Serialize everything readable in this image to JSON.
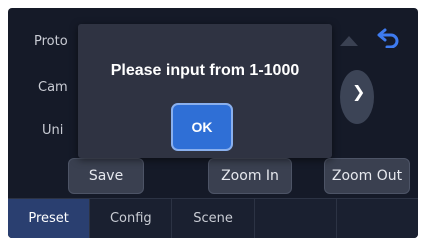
{
  "form": {
    "protocol_label": "Proto",
    "camera_label": "Cam",
    "unit_label": "Uni"
  },
  "controls": {
    "save_label": "Save",
    "zoom_in_label": "Zoom In",
    "zoom_out_label": "Zoom Out",
    "right_arrow_glyph": "❯"
  },
  "icons": {
    "back": "back-arrow-icon",
    "pan_up": "up-arrow-icon",
    "pan_right": "right-arrow-icon"
  },
  "tabs": [
    {
      "label": "Preset",
      "active": true
    },
    {
      "label": "Config",
      "active": false
    },
    {
      "label": "Scene",
      "active": false
    },
    {
      "label": "",
      "active": false
    },
    {
      "label": "",
      "active": false
    }
  ],
  "dialog": {
    "message": "Please input from 1-1000",
    "ok_label": "OK"
  },
  "colors": {
    "background": "#151a28",
    "dialog": "#2f3342",
    "accent": "#2f6fd6",
    "active_tab": "#2a3f70"
  }
}
